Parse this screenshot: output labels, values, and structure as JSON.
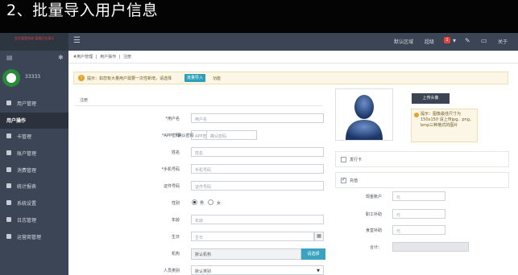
{
  "banner": {
    "title": "2、批量导入用户信息"
  },
  "sidebar": {
    "brand_text": "会员管理系统 管理后台演示",
    "user_name": "33333",
    "items": [
      {
        "label": "用户管理",
        "active": false
      },
      {
        "label": "用户操作",
        "active": true
      },
      {
        "label": "卡管理",
        "active": false
      },
      {
        "label": "账户管理",
        "active": false
      },
      {
        "label": "消费管理",
        "active": false
      },
      {
        "label": "统计报表",
        "active": false
      },
      {
        "label": "系统设置",
        "active": false
      },
      {
        "label": "日志管理",
        "active": false
      },
      {
        "label": "运营商管理",
        "active": false
      }
    ]
  },
  "topbar": {
    "menu_icon": "menu-icon",
    "region": "默认区域",
    "account": "超级",
    "badge_count": "1",
    "icons": [
      "edit-icon",
      "monitor-icon"
    ],
    "about": "关于"
  },
  "breadcrumb": [
    "#用户管理",
    "用户操作",
    "注册"
  ],
  "tip": {
    "text": "提示：如您有大量用户需要一次性新增，请选择",
    "button": "批量导入",
    "after": "功能"
  },
  "form": {
    "panel_title": "注册",
    "fields": {
      "user_name": {
        "label": "*用户名",
        "placeholder": "用户名"
      },
      "app_password": {
        "label": "*APP密码",
        "placeholder": "APP密码"
      },
      "confirm_password": {
        "label": "*确认密码",
        "placeholder": "确认密码"
      },
      "full_name": {
        "label": "姓名",
        "placeholder": "姓名"
      },
      "phone": {
        "label": "*手机号码",
        "placeholder": "手机号码"
      },
      "id_number": {
        "label": "证件号码",
        "placeholder": "证件号码"
      },
      "gender": {
        "label": "性别",
        "options": [
          "男",
          "女"
        ],
        "selected": "男"
      },
      "age": {
        "label": "年龄",
        "placeholder": "年龄"
      },
      "birthday": {
        "label": "生日",
        "placeholder": "生日"
      },
      "organization": {
        "label": "机构",
        "value": "默认机构",
        "button": "请选择"
      },
      "category": {
        "label": "人员类别",
        "value": "默认类别"
      }
    }
  },
  "photo": {
    "upload_button": "上传头像",
    "tip": "提示：图像最佳尺寸为150x150 请上传jpg、png、bmp三种格式的图片"
  },
  "cards": [
    {
      "label": "发行卡",
      "checked": false
    },
    {
      "label": "充值",
      "checked": true
    }
  ],
  "recharge": {
    "cash_label": "现金账户",
    "cash_placeholder": "元",
    "subsidy_label": "职工补助",
    "subsidy_placeholder": "元",
    "meal_label": "食堂补助",
    "meal_placeholder": "元",
    "total_label": "合计："
  }
}
